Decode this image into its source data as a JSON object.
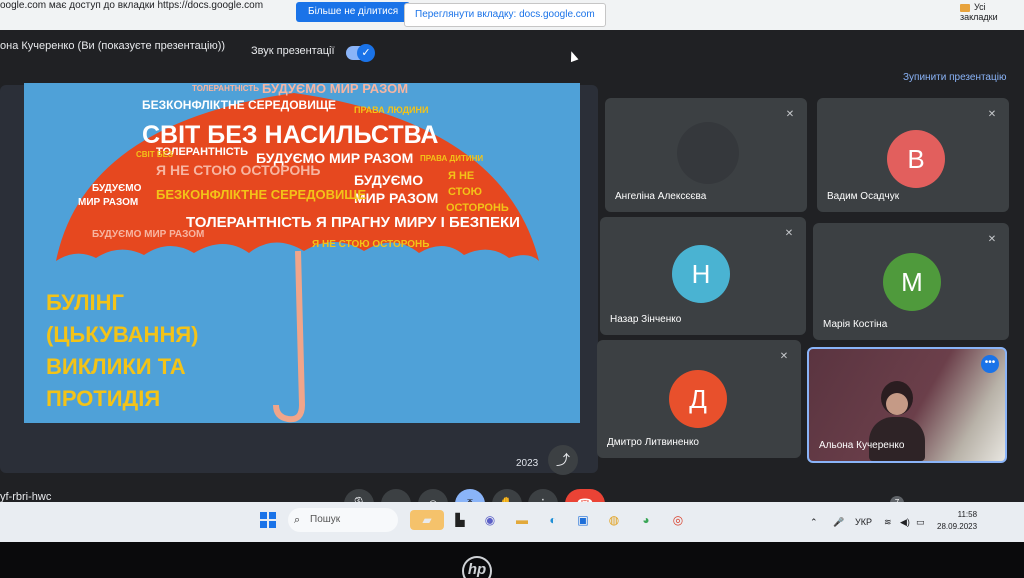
{
  "share_bar": {
    "notice": "oogle.com має доступ до вкладки https://docs.google.com",
    "stop_sharing": "Більше не ділитися",
    "switch_tab": "Переглянути вкладку: docs.google.com",
    "bookmarks": "Усі закладки"
  },
  "header": {
    "presenter": "она Кучеренко (Ви (показуєте презентацію))",
    "sound_label": "Звук презентації",
    "sound_enabled": true,
    "stop_presenting": "Зупинити презентацію"
  },
  "slide": {
    "title_lines": [
      "БУЛІНГ",
      "(ЦЬКУВАННЯ)",
      "ВИКЛИКИ ТА",
      "ПРОТИДІЯ"
    ],
    "umbrella_words": [
      "ТОЛЕРАНТНІСТЬ",
      "БУДУЄМО МИР РАЗОМ",
      "БЕЗКОНФЛІКТНЕ СЕРЕДОВИЩЕ",
      "ПРАВА ЛЮДИНИ",
      "СВІТ БЕЗ НАСИЛЬСТВА",
      "ТОЛЕРАНТНІСТЬ",
      "БУДУЄМО МИР РАЗОМ",
      "ПРАВА ДИТИНИ",
      "Я НЕ СТОЮ ОСТОРОНЬ",
      "БУДУЄМО",
      "МИР РАЗОМ",
      "Я НЕ",
      "СТОЮ",
      "ОСТОРОНЬ",
      "БЕЗКОНФЛІКТНЕ СЕРЕДОВИЩЕ",
      "БУДУЄМО",
      "МИР РАЗОМ",
      "ТОЛЕРАНТНІСТЬ",
      "Я ПРАГНУ МИРУ І БЕЗПЕКИ",
      "БУДУЄМО МИР РАЗОМ",
      "Я НЕ СТОЮ ОСТОРОНЬ",
      "СВІТ БЕЗ"
    ],
    "year": "2023"
  },
  "participants": [
    {
      "name": "Ангеліна Алексєєва",
      "initial": "",
      "color": "#4a4f55",
      "muted": true
    },
    {
      "name": "Вадим Осадчук",
      "initial": "В",
      "color": "#e25f5d",
      "muted": true
    },
    {
      "name": "Назар Зінченко",
      "initial": "Н",
      "color": "#4ab3d2",
      "muted": true
    },
    {
      "name": "Марія Костіна",
      "initial": "М",
      "color": "#4f9a3c",
      "muted": true
    },
    {
      "name": "Дмитро Литвиненко",
      "initial": "Д",
      "color": "#e8502c",
      "muted": true
    },
    {
      "name": "Альона Кучеренко",
      "initial": "",
      "color": "",
      "muted": false
    }
  ],
  "footer": {
    "meeting_code": "yf-rbri-hwc",
    "people_count": "7"
  },
  "taskbar": {
    "search_placeholder": "Пошук",
    "language": "УКР",
    "time": "11:58",
    "date": "28.09.2023"
  },
  "device": {
    "brand": "hp"
  },
  "icons": [
    "mic-icon",
    "camera-icon",
    "emoji-icon",
    "present-icon",
    "raise-hand-icon",
    "more-icon",
    "hangup-icon",
    "info-icon",
    "people-icon",
    "chat-icon",
    "activities-icon",
    "lock-icon",
    "share-icon",
    "windows-start-icon",
    "search-icon"
  ]
}
